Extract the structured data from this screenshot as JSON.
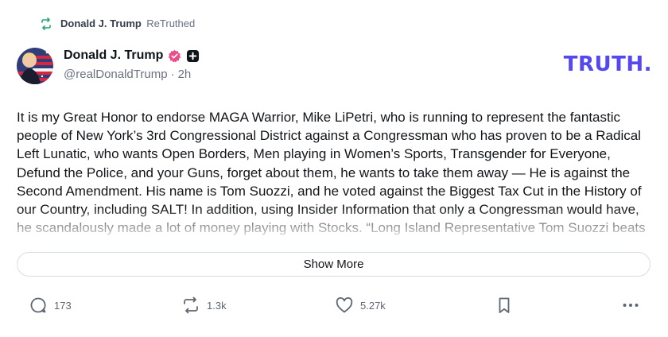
{
  "retruth": {
    "author": "Donald J. Trump",
    "label": "ReTruthed"
  },
  "author": {
    "name": "Donald J. Trump",
    "handle": "@realDonaldTrump",
    "separator": "·",
    "time": "2h"
  },
  "brand": {
    "logo_text": "TRUTH",
    "logo_dot": ".",
    "accent": "#5448ee"
  },
  "post": {
    "text": "It is my Great Honor to endorse MAGA Warrior, Mike LiPetri, who is running to represent the fantastic people of New York’s 3rd Congressional District against a Congressman who has proven to be a Radical Left Lunatic, who wants Open Borders, Men playing in Women’s Sports, Transgender for Everyone, Defund the Police, and your Guns, forget about them, he wants to take them away — He is against the Second Amendment. His name is Tom Suozzi, and he voted against the Biggest Tax Cut in the History of our Country, including SALT! In addition, using Insider Information that only a Congressman would have, he scandalously made a lot of money playing with Stocks. “Long Island Representative Tom Suozzi beats Pelosi’s stock portfolio"
  },
  "show_more_label": "Show More",
  "actions": {
    "replies": "173",
    "retruths": "1.3k",
    "likes": "5.27k"
  },
  "icons": {
    "retruth": "retruth-icon",
    "verified": "verified-badge-icon",
    "plus": "plus-badge-icon",
    "reply": "reply-icon",
    "like": "heart-icon",
    "bookmark": "bookmark-icon",
    "more": "more-icon"
  }
}
